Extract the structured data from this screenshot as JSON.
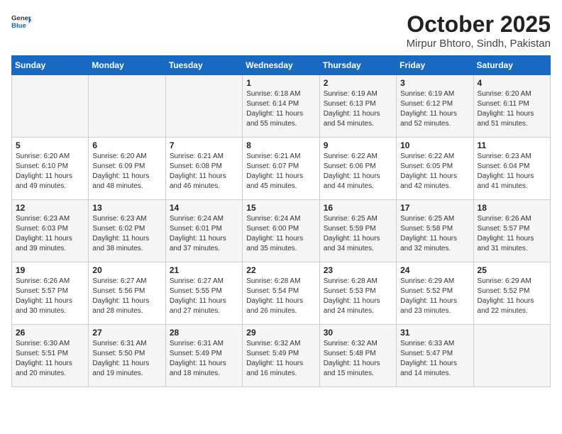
{
  "logo": {
    "general": "General",
    "blue": "Blue"
  },
  "title": "October 2025",
  "subtitle": "Mirpur Bhtoro, Sindh, Pakistan",
  "headers": [
    "Sunday",
    "Monday",
    "Tuesday",
    "Wednesday",
    "Thursday",
    "Friday",
    "Saturday"
  ],
  "weeks": [
    [
      {
        "day": "",
        "sunrise": "",
        "sunset": "",
        "daylight": ""
      },
      {
        "day": "",
        "sunrise": "",
        "sunset": "",
        "daylight": ""
      },
      {
        "day": "",
        "sunrise": "",
        "sunset": "",
        "daylight": ""
      },
      {
        "day": "1",
        "sunrise": "Sunrise: 6:18 AM",
        "sunset": "Sunset: 6:14 PM",
        "daylight": "Daylight: 11 hours and 55 minutes."
      },
      {
        "day": "2",
        "sunrise": "Sunrise: 6:19 AM",
        "sunset": "Sunset: 6:13 PM",
        "daylight": "Daylight: 11 hours and 54 minutes."
      },
      {
        "day": "3",
        "sunrise": "Sunrise: 6:19 AM",
        "sunset": "Sunset: 6:12 PM",
        "daylight": "Daylight: 11 hours and 52 minutes."
      },
      {
        "day": "4",
        "sunrise": "Sunrise: 6:20 AM",
        "sunset": "Sunset: 6:11 PM",
        "daylight": "Daylight: 11 hours and 51 minutes."
      }
    ],
    [
      {
        "day": "5",
        "sunrise": "Sunrise: 6:20 AM",
        "sunset": "Sunset: 6:10 PM",
        "daylight": "Daylight: 11 hours and 49 minutes."
      },
      {
        "day": "6",
        "sunrise": "Sunrise: 6:20 AM",
        "sunset": "Sunset: 6:09 PM",
        "daylight": "Daylight: 11 hours and 48 minutes."
      },
      {
        "day": "7",
        "sunrise": "Sunrise: 6:21 AM",
        "sunset": "Sunset: 6:08 PM",
        "daylight": "Daylight: 11 hours and 46 minutes."
      },
      {
        "day": "8",
        "sunrise": "Sunrise: 6:21 AM",
        "sunset": "Sunset: 6:07 PM",
        "daylight": "Daylight: 11 hours and 45 minutes."
      },
      {
        "day": "9",
        "sunrise": "Sunrise: 6:22 AM",
        "sunset": "Sunset: 6:06 PM",
        "daylight": "Daylight: 11 hours and 44 minutes."
      },
      {
        "day": "10",
        "sunrise": "Sunrise: 6:22 AM",
        "sunset": "Sunset: 6:05 PM",
        "daylight": "Daylight: 11 hours and 42 minutes."
      },
      {
        "day": "11",
        "sunrise": "Sunrise: 6:23 AM",
        "sunset": "Sunset: 6:04 PM",
        "daylight": "Daylight: 11 hours and 41 minutes."
      }
    ],
    [
      {
        "day": "12",
        "sunrise": "Sunrise: 6:23 AM",
        "sunset": "Sunset: 6:03 PM",
        "daylight": "Daylight: 11 hours and 39 minutes."
      },
      {
        "day": "13",
        "sunrise": "Sunrise: 6:23 AM",
        "sunset": "Sunset: 6:02 PM",
        "daylight": "Daylight: 11 hours and 38 minutes."
      },
      {
        "day": "14",
        "sunrise": "Sunrise: 6:24 AM",
        "sunset": "Sunset: 6:01 PM",
        "daylight": "Daylight: 11 hours and 37 minutes."
      },
      {
        "day": "15",
        "sunrise": "Sunrise: 6:24 AM",
        "sunset": "Sunset: 6:00 PM",
        "daylight": "Daylight: 11 hours and 35 minutes."
      },
      {
        "day": "16",
        "sunrise": "Sunrise: 6:25 AM",
        "sunset": "Sunset: 5:59 PM",
        "daylight": "Daylight: 11 hours and 34 minutes."
      },
      {
        "day": "17",
        "sunrise": "Sunrise: 6:25 AM",
        "sunset": "Sunset: 5:58 PM",
        "daylight": "Daylight: 11 hours and 32 minutes."
      },
      {
        "day": "18",
        "sunrise": "Sunrise: 6:26 AM",
        "sunset": "Sunset: 5:57 PM",
        "daylight": "Daylight: 11 hours and 31 minutes."
      }
    ],
    [
      {
        "day": "19",
        "sunrise": "Sunrise: 6:26 AM",
        "sunset": "Sunset: 5:57 PM",
        "daylight": "Daylight: 11 hours and 30 minutes."
      },
      {
        "day": "20",
        "sunrise": "Sunrise: 6:27 AM",
        "sunset": "Sunset: 5:56 PM",
        "daylight": "Daylight: 11 hours and 28 minutes."
      },
      {
        "day": "21",
        "sunrise": "Sunrise: 6:27 AM",
        "sunset": "Sunset: 5:55 PM",
        "daylight": "Daylight: 11 hours and 27 minutes."
      },
      {
        "day": "22",
        "sunrise": "Sunrise: 6:28 AM",
        "sunset": "Sunset: 5:54 PM",
        "daylight": "Daylight: 11 hours and 26 minutes."
      },
      {
        "day": "23",
        "sunrise": "Sunrise: 6:28 AM",
        "sunset": "Sunset: 5:53 PM",
        "daylight": "Daylight: 11 hours and 24 minutes."
      },
      {
        "day": "24",
        "sunrise": "Sunrise: 6:29 AM",
        "sunset": "Sunset: 5:52 PM",
        "daylight": "Daylight: 11 hours and 23 minutes."
      },
      {
        "day": "25",
        "sunrise": "Sunrise: 6:29 AM",
        "sunset": "Sunset: 5:52 PM",
        "daylight": "Daylight: 11 hours and 22 minutes."
      }
    ],
    [
      {
        "day": "26",
        "sunrise": "Sunrise: 6:30 AM",
        "sunset": "Sunset: 5:51 PM",
        "daylight": "Daylight: 11 hours and 20 minutes."
      },
      {
        "day": "27",
        "sunrise": "Sunrise: 6:31 AM",
        "sunset": "Sunset: 5:50 PM",
        "daylight": "Daylight: 11 hours and 19 minutes."
      },
      {
        "day": "28",
        "sunrise": "Sunrise: 6:31 AM",
        "sunset": "Sunset: 5:49 PM",
        "daylight": "Daylight: 11 hours and 18 minutes."
      },
      {
        "day": "29",
        "sunrise": "Sunrise: 6:32 AM",
        "sunset": "Sunset: 5:49 PM",
        "daylight": "Daylight: 11 hours and 16 minutes."
      },
      {
        "day": "30",
        "sunrise": "Sunrise: 6:32 AM",
        "sunset": "Sunset: 5:48 PM",
        "daylight": "Daylight: 11 hours and 15 minutes."
      },
      {
        "day": "31",
        "sunrise": "Sunrise: 6:33 AM",
        "sunset": "Sunset: 5:47 PM",
        "daylight": "Daylight: 11 hours and 14 minutes."
      },
      {
        "day": "",
        "sunrise": "",
        "sunset": "",
        "daylight": ""
      }
    ]
  ]
}
